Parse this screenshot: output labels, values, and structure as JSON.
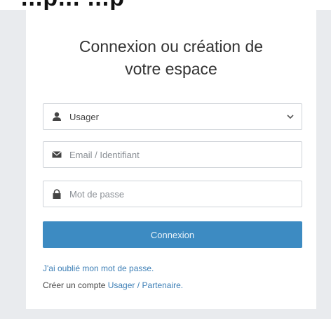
{
  "header": {
    "fragment": "...p... ...p"
  },
  "card": {
    "title_line1": "Connexion ou création de",
    "title_line2": "votre espace"
  },
  "form": {
    "account_type": {
      "selected": "Usager",
      "options": [
        "Usager"
      ]
    },
    "email": {
      "placeholder": "Email / Identifiant",
      "value": ""
    },
    "password": {
      "placeholder": "Mot de passe",
      "value": ""
    },
    "submit_label": "Connexion"
  },
  "links": {
    "forgot_password": "J'ai oublié mon mot de passe.",
    "create_account_prefix": "Créer un compte",
    "usager": "Usager",
    "separator": "/",
    "partenaire": "Partenaire."
  },
  "icons": {
    "account_type": "user-icon",
    "email": "envelope-icon",
    "password": "lock-icon",
    "dropdown": "chevron-down-icon"
  },
  "colors": {
    "primary_button": "#3d8bc2",
    "link": "#3d7fb6",
    "page_background": "#e9ebee"
  }
}
